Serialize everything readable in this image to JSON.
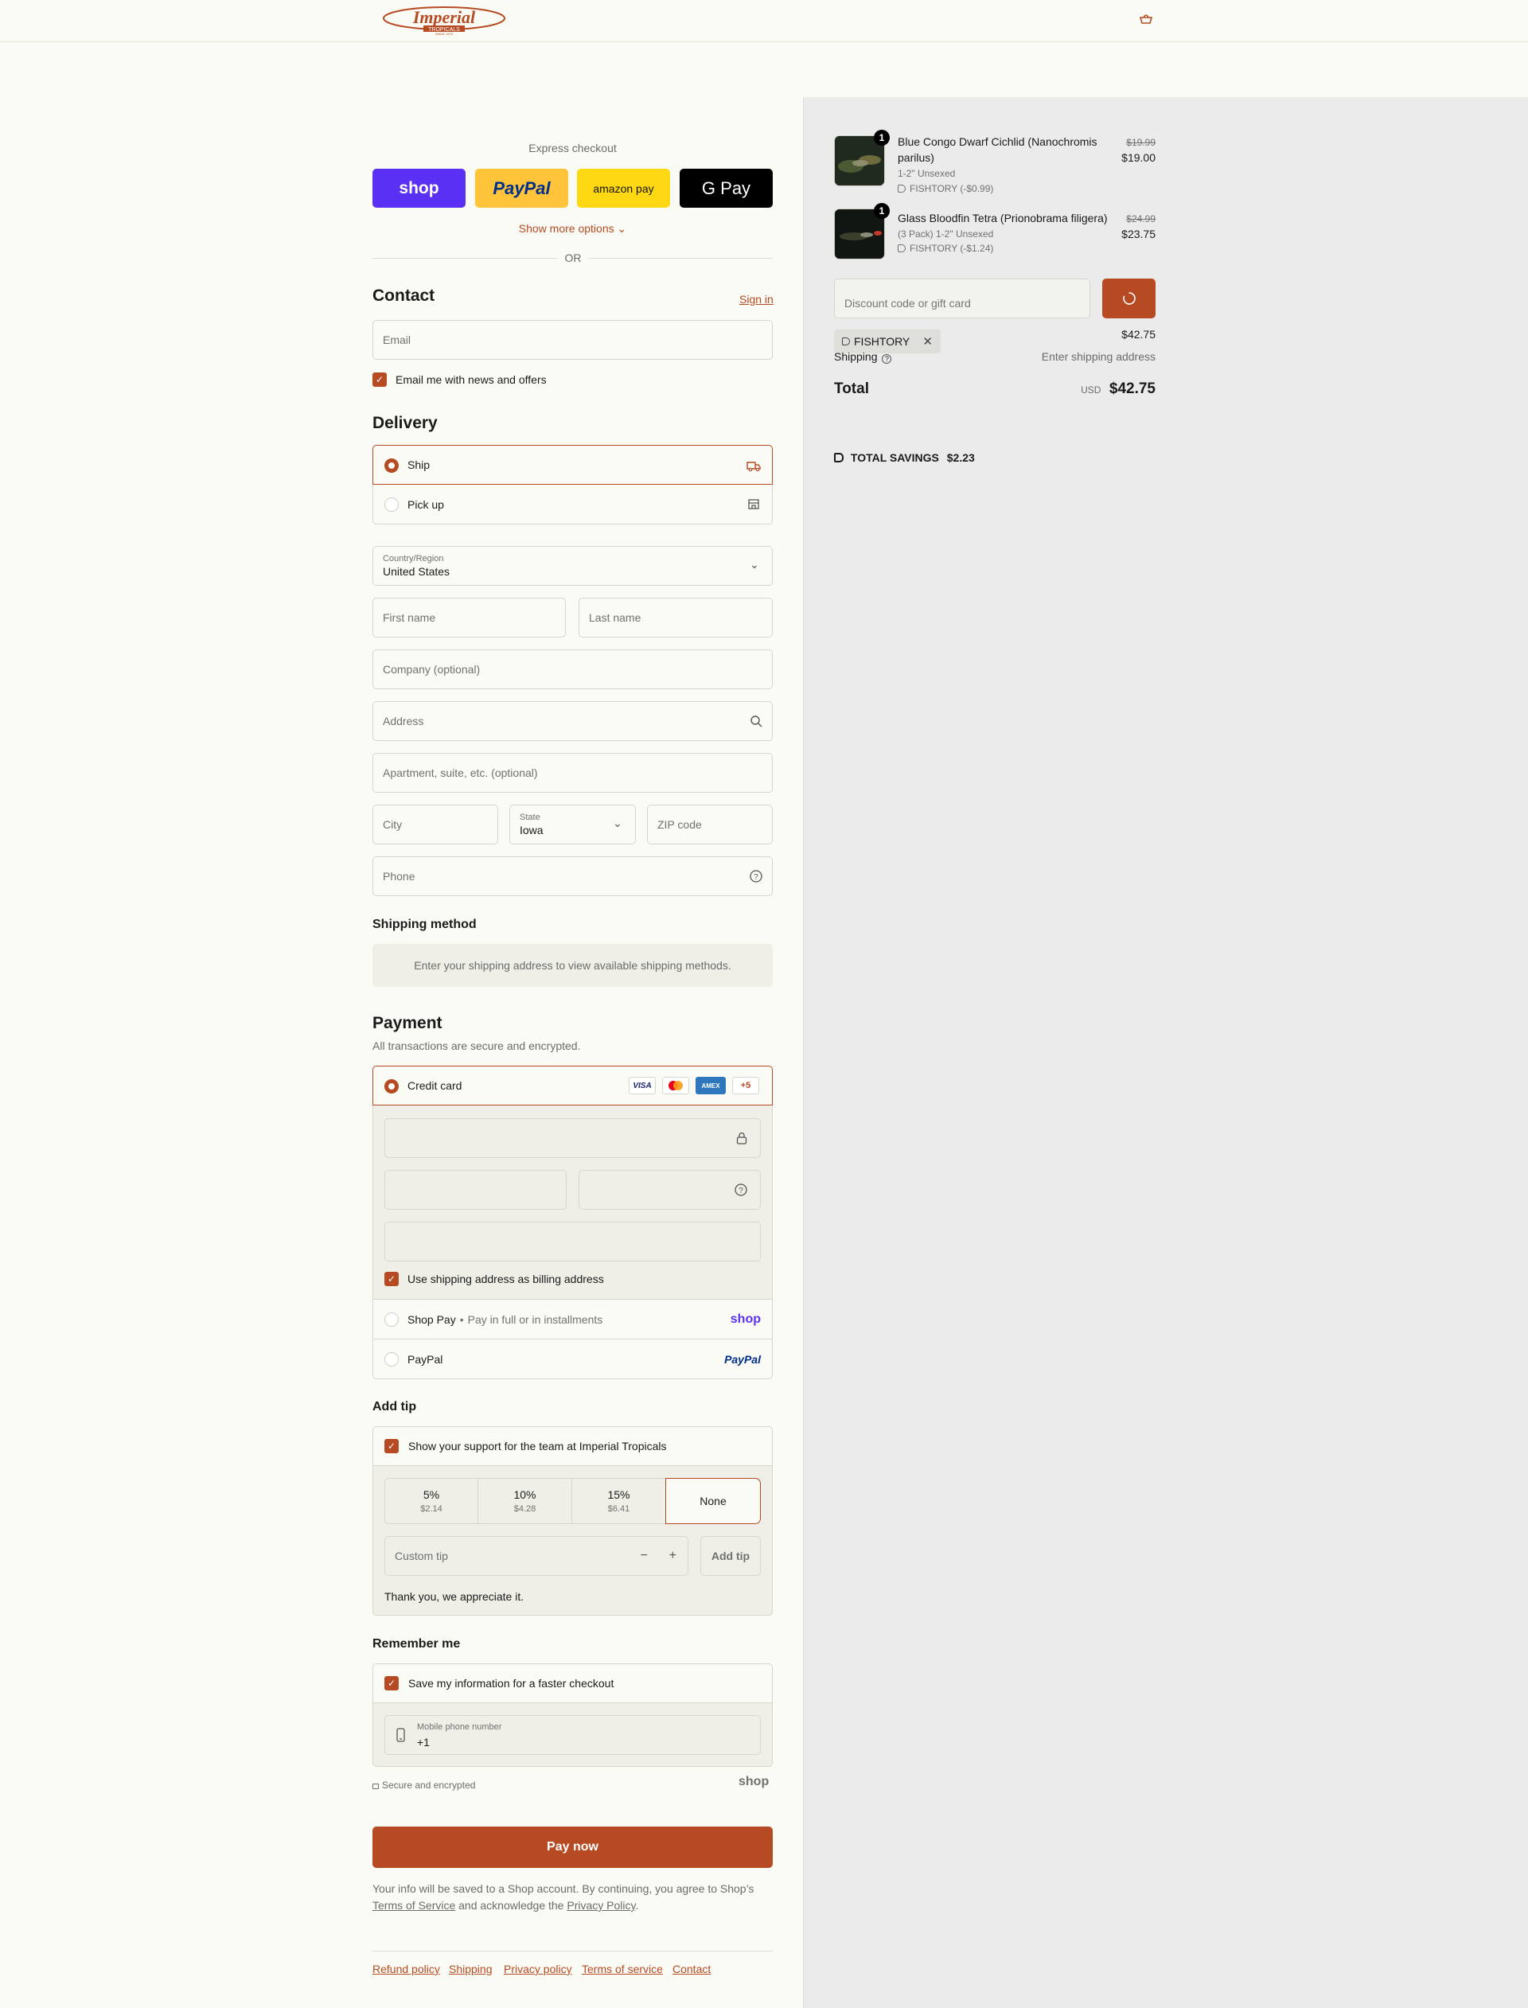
{
  "brand": {
    "logo_text": "Imperial",
    "logo_sub": "TROPICALS",
    "logo_since": "SINCE 1979"
  },
  "express": {
    "title": "Express checkout",
    "shop_label": "shop",
    "paypal_label": "PayPal",
    "amazon_label": "amazon pay",
    "gpay_label": "G Pay",
    "more_options": "Show more options",
    "or_text": "OR"
  },
  "contact": {
    "heading": "Contact",
    "sign_in": "Sign in",
    "email_placeholder": "Email",
    "news_label": "Email me with news and offers"
  },
  "delivery": {
    "heading": "Delivery",
    "ship_label": "Ship",
    "pickup_label": "Pick up",
    "country_label": "Country/Region",
    "country_value": "United States",
    "first_name": "First name",
    "last_name": "Last name",
    "company": "Company (optional)",
    "address": "Address",
    "apartment": "Apartment, suite, etc. (optional)",
    "city": "City",
    "state_label": "State",
    "state_value": "Iowa",
    "zip": "ZIP code",
    "phone": "Phone"
  },
  "shipping_method": {
    "heading": "Shipping method",
    "note": "Enter your shipping address to view available shipping methods."
  },
  "payment": {
    "heading": "Payment",
    "subtitle": "All transactions are secure and encrypted.",
    "credit_card_label": "Credit card",
    "card_logos": [
      "VISA",
      "MC",
      "AMEX"
    ],
    "more_cards": "+5",
    "billing_label": "Use shipping address as billing address",
    "shop_pay_label": "Shop Pay",
    "shop_pay_sub": "Pay in full or in installments",
    "shop_pay_logo": "shop",
    "paypal_label": "PayPal",
    "paypal_logo": "PayPal"
  },
  "tip": {
    "heading": "Add tip",
    "support_label": "Show your support for the team at Imperial Tropicals",
    "options": [
      {
        "pct": "5%",
        "amount": "$2.14"
      },
      {
        "pct": "10%",
        "amount": "$4.28"
      },
      {
        "pct": "15%",
        "amount": "$6.41"
      },
      {
        "pct": "None",
        "amount": ""
      }
    ],
    "custom_placeholder": "Custom tip",
    "add_button": "Add tip",
    "thanks": "Thank you, we appreciate it."
  },
  "remember": {
    "heading": "Remember me",
    "save_label": "Save my information for a faster checkout",
    "mobile_label": "Mobile phone number",
    "mobile_value": "+1",
    "secure_text": "Secure and encrypted",
    "shop_logo": "shop"
  },
  "pay_now": "Pay now",
  "legal": {
    "text_1": "Your info will be saved to a Shop account. By continuing, you agree to Shop’s",
    "tos": "Terms of Service",
    "and": "and acknowledge the",
    "privacy": "Privacy Policy",
    "end": "."
  },
  "footer_links": [
    "Refund policy",
    "Shipping",
    "Privacy policy",
    "Terms of service",
    "Contact"
  ],
  "summary": {
    "items": [
      {
        "qty": "1",
        "name_line1": "Blue Congo Dwarf Cichlid (Nanochromis",
        "name_line2": "parilus)",
        "variant": "1-2\" Unsexed",
        "discount": "FISHTORY (-$0.99)",
        "original_price": "$19.99",
        "price": "$19.00"
      },
      {
        "qty": "1",
        "name_line1": "Glass Bloodfin Tetra (Prionobrama filigera)",
        "name_line2": "",
        "variant": "(3 Pack) 1-2\" Unsexed",
        "discount": "FISHTORY (-$1.24)",
        "original_price": "$24.99",
        "price": "$23.75"
      }
    ],
    "discount_placeholder": "Discount code or gift card",
    "applied_code": "FISHTORY",
    "subtotal_value": "$42.75",
    "shipping_label": "Shipping",
    "shipping_value": "Enter shipping address",
    "total_label": "Total",
    "currency": "USD",
    "total_value": "$42.75",
    "savings_label": "TOTAL SAVINGS",
    "savings_value": "$2.23"
  },
  "colors": {
    "accent": "#b64a22",
    "background": "#fbfbf5",
    "summary_bg": "#ebebeb"
  }
}
